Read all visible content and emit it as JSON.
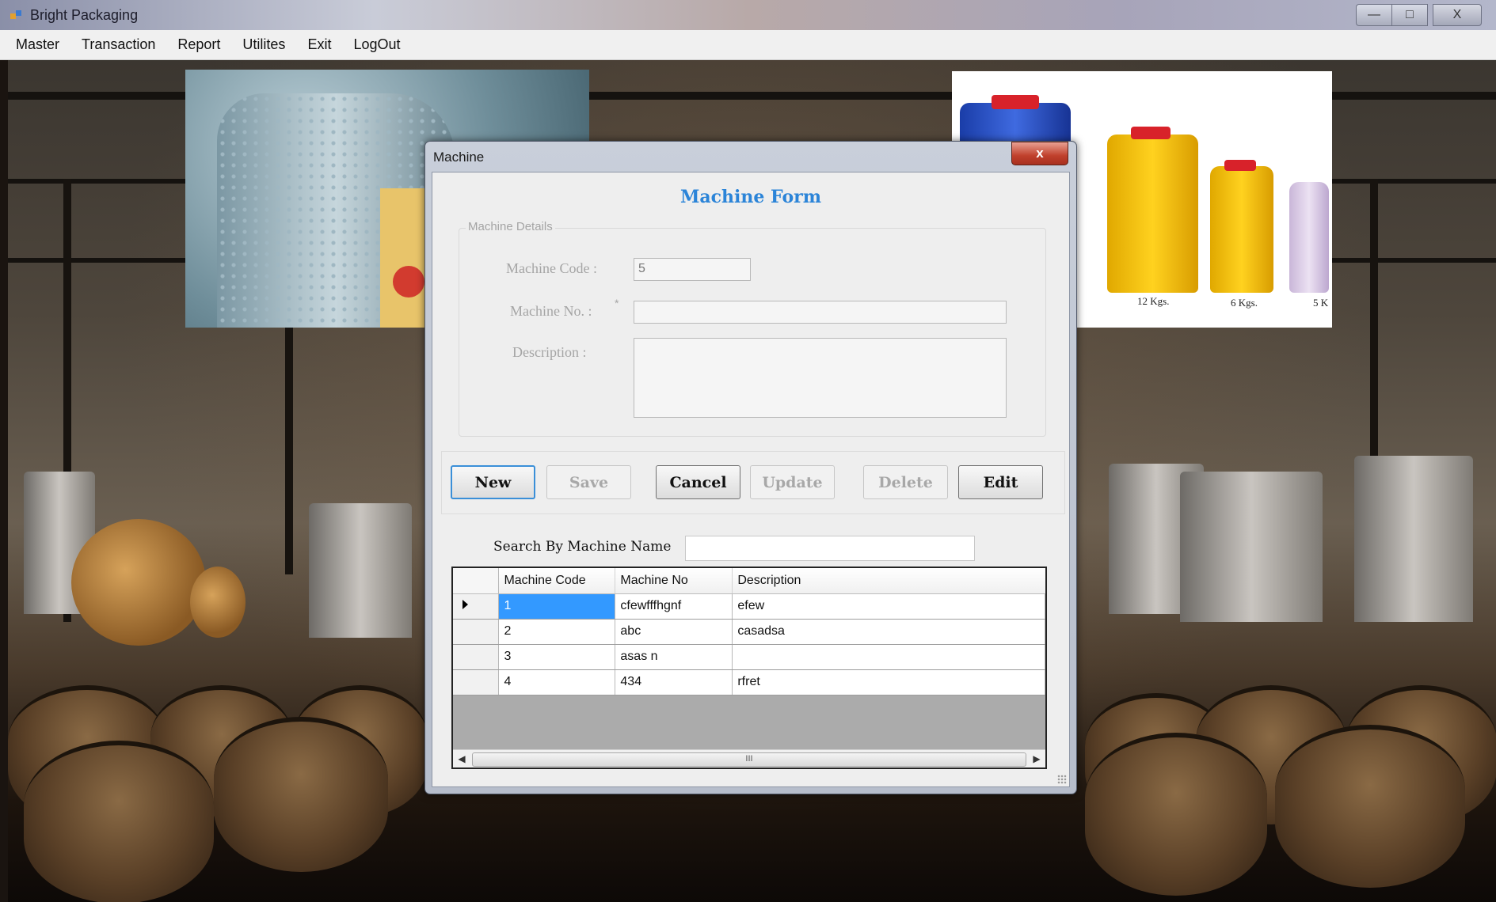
{
  "window": {
    "title": "Bright Packaging",
    "buttons": {
      "minimize": "—",
      "maximize": "□",
      "close": "X"
    }
  },
  "menubar": {
    "items": [
      "Master",
      "Transaction",
      "Report",
      "Utilites",
      "Exit",
      "LogOut"
    ]
  },
  "background": {
    "jar_labels": [
      "12 Kgs.",
      "6 Kgs.",
      "5 K"
    ]
  },
  "dialog": {
    "title": "Machine",
    "close_label": "x",
    "form_title": "Machine Form",
    "group": {
      "legend": "Machine Details",
      "fields": {
        "code_label": "Machine Code :",
        "code_value": "5",
        "no_label": "Machine No. :",
        "no_required": "*",
        "no_value": "",
        "desc_label": "Description :",
        "desc_value": ""
      }
    },
    "buttons": {
      "new": "New",
      "save": "Save",
      "cancel": "Cancel",
      "update": "Update",
      "delete": "Delete",
      "edit": "Edit"
    },
    "search": {
      "label": "Search By Machine Name",
      "value": ""
    },
    "grid": {
      "columns": [
        "Machine Code",
        "Machine No",
        "Description"
      ],
      "rows": [
        [
          "1",
          "cfewfffhgnf",
          "efew"
        ],
        [
          "2",
          "abc",
          "casadsa"
        ],
        [
          "3",
          "asas n",
          ""
        ],
        [
          "4",
          "434",
          "rfret"
        ]
      ],
      "scroll_thumb_text": "III"
    }
  }
}
